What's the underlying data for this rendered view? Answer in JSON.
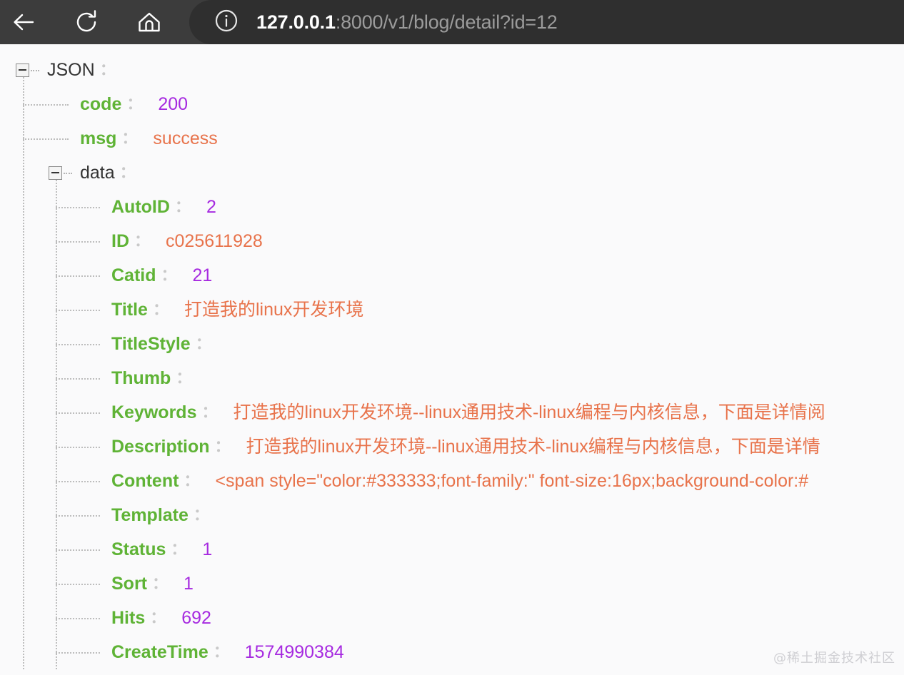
{
  "browser": {
    "back_label": "Back",
    "reload_label": "Reload",
    "home_label": "Home",
    "security_icon_label": "Site information",
    "url_host": "127.0.0.1",
    "url_rest": ":8000/v1/blog/detail?id=12",
    "toolbar_bg": "#3c3c3c",
    "url_pill_bg": "#2f2f2f"
  },
  "viewer": {
    "background": "#fafafb",
    "key_color": "#5fb336",
    "number_color": "#a62ae0",
    "string_color": "#e8734b",
    "root_label_color": "#343434",
    "colon": "：",
    "watermark": "@稀土掘金技术社区"
  },
  "json_tree": {
    "root": {
      "label": "JSON",
      "toggle": "collapse-box-minus"
    },
    "rows": [
      {
        "key": "code",
        "value": "200",
        "type": "number"
      },
      {
        "key": "msg",
        "value": "success",
        "type": "string"
      },
      {
        "key": "data",
        "value": "",
        "type": "object",
        "toggle": "collapse-box-minus"
      },
      {
        "key": "AutoID",
        "value": "2",
        "type": "number"
      },
      {
        "key": "ID",
        "value": "c025611928",
        "type": "string"
      },
      {
        "key": "Catid",
        "value": "21",
        "type": "number"
      },
      {
        "key": "Title",
        "value": "打造我的linux开发环境",
        "type": "string"
      },
      {
        "key": "TitleStyle",
        "value": "",
        "type": "string"
      },
      {
        "key": "Thumb",
        "value": "",
        "type": "string"
      },
      {
        "key": "Keywords",
        "value": "打造我的linux开发环境--linux通用技术-linux编程与内核信息，下面是详情阅",
        "type": "string"
      },
      {
        "key": "Description",
        "value": "打造我的linux开发环境--linux通用技术-linux编程与内核信息，下面是详情",
        "type": "string"
      },
      {
        "key": "Content",
        "value": "<span style=\"color:#333333;font-family:\" font-size:16px;background-color:#",
        "type": "string"
      },
      {
        "key": "Template",
        "value": "",
        "type": "string"
      },
      {
        "key": "Status",
        "value": "1",
        "type": "number"
      },
      {
        "key": "Sort",
        "value": "1",
        "type": "number"
      },
      {
        "key": "Hits",
        "value": "692",
        "type": "number"
      },
      {
        "key": "CreateTime",
        "value": "1574990384",
        "type": "number"
      }
    ]
  }
}
